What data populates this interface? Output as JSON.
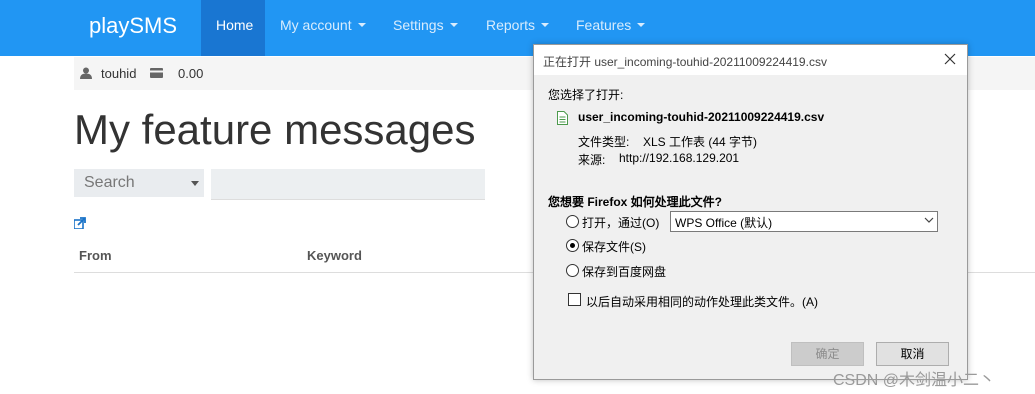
{
  "nav": {
    "brand": "playSMS",
    "items": [
      {
        "label": "Home"
      },
      {
        "label": "My account"
      },
      {
        "label": "Settings"
      },
      {
        "label": "Reports"
      },
      {
        "label": "Features"
      }
    ]
  },
  "userbar": {
    "username": "touhid",
    "credit": "0.00",
    "user_icon": "user-icon",
    "credit_icon": "credit-card-icon"
  },
  "page": {
    "title": "My feature messages",
    "search_select_value": "Search",
    "search_input_value": "",
    "export_icon": "export-icon",
    "table_headers": [
      "From",
      "Keyword"
    ]
  },
  "dialog": {
    "title": "正在打开 user_incoming-touhid-20211009224419.csv",
    "chosen_label": "您选择了打开:",
    "filename": "user_incoming-touhid-20211009224419.csv",
    "file_type_label": "文件类型:",
    "file_type_value": "XLS 工作表 (44 字节)",
    "source_label": "来源:",
    "source_value": "http://192.168.129.201",
    "question": "您想要 Firefox 如何处理此文件?",
    "open_with_label": "打开，通过(O)",
    "open_with_app": "WPS Office (默认)",
    "save_file_label": "保存文件(S)",
    "save_to_baidu_label": "保存到百度网盘",
    "auto_label": "以后自动采用相同的动作处理此类文件。(A)",
    "ok_label": "确定",
    "cancel_label": "取消",
    "selected_option": "save_file"
  },
  "watermark": "CSDN @木剑温小二丶",
  "colors": {
    "navbar": "#2196f3",
    "nav_active": "#1976d2",
    "dialog_bg": "#f0f0f0"
  }
}
